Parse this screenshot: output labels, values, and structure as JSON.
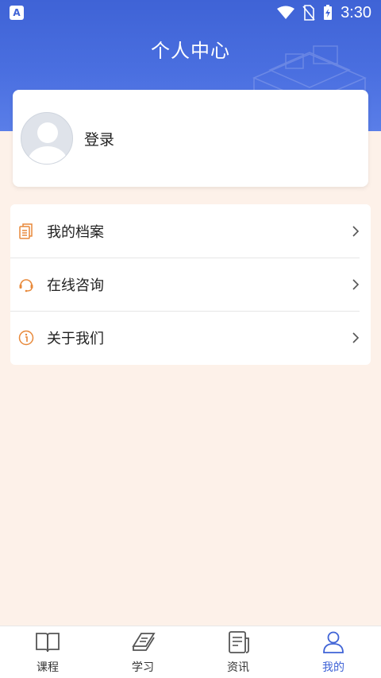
{
  "status_bar": {
    "time": "3:30",
    "app_badge": "A"
  },
  "header": {
    "title": "个人中心"
  },
  "profile": {
    "login_label": "登录"
  },
  "menu": {
    "items": [
      {
        "label": "我的档案",
        "icon": "document-icon"
      },
      {
        "label": "在线咨询",
        "icon": "headset-icon"
      },
      {
        "label": "关于我们",
        "icon": "info-icon"
      }
    ]
  },
  "tabbar": {
    "tabs": [
      {
        "label": "课程",
        "icon": "open-book-icon",
        "active": false
      },
      {
        "label": "学习",
        "icon": "book-icon",
        "active": false
      },
      {
        "label": "资讯",
        "icon": "news-icon",
        "active": false
      },
      {
        "label": "我的",
        "icon": "user-icon",
        "active": true
      }
    ]
  },
  "colors": {
    "primary": "#3f63d6",
    "accent_orange": "#e8893a",
    "background": "#fdf1e9"
  }
}
